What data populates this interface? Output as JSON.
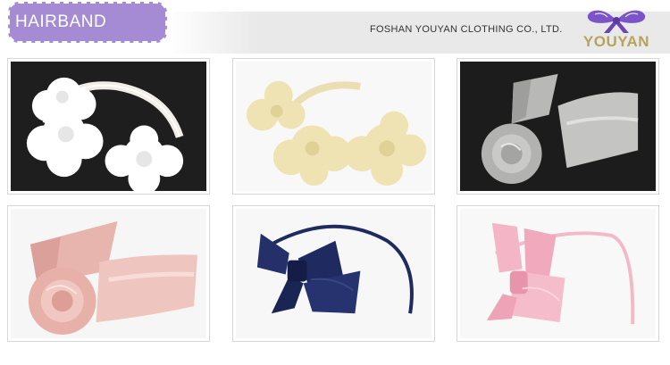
{
  "header": {
    "title": "HAIRBAND",
    "company": "FOSHAN YOUYAN CLOTHING CO., LTD.",
    "logo_text": "YOUYAN"
  },
  "products": [
    {
      "name": "white chiffon flower hairband"
    },
    {
      "name": "cream chiffon flower hairband"
    },
    {
      "name": "silver satin rose hairband"
    },
    {
      "name": "pink satin rose hairband"
    },
    {
      "name": "navy bow hairband"
    },
    {
      "name": "pink bow hairband"
    }
  ],
  "colors": {
    "tag_purple": "#a58bd4",
    "logo_purple": "#7b55c8",
    "logo_gold": "#b8a35a"
  }
}
